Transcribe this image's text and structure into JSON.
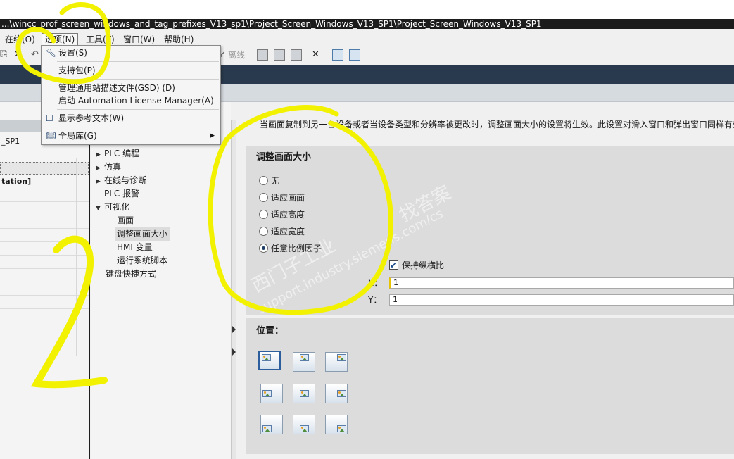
{
  "window": {
    "title": "...\\wincc_prof_screen_windows_and_tag_prefixes_V13_sp1\\Project_Screen_Windows_V13_SP1\\Project_Screen_Windows_V13_SP1"
  },
  "menubar": {
    "items": [
      {
        "label": "在线(O)"
      },
      {
        "label": "选项(N)"
      },
      {
        "label": "工具(T)"
      },
      {
        "label": "窗口(W)"
      },
      {
        "label": "帮助(H)"
      }
    ]
  },
  "toolbar": {
    "offline_label": "离线"
  },
  "options_menu": {
    "settings": "设置(S)",
    "support_packages": "支持包(P)",
    "manage_gsd": "管理通用站描述文件(GSD) (D)",
    "start_alm": "启动 Automation License Manager(A)",
    "show_reference_text": "显示参考文本(W)",
    "global_libraries": "全局库(G)"
  },
  "left_panel": {
    "row1": "_SP1",
    "row2": "tation]"
  },
  "tree": {
    "items": [
      {
        "label": "PLC 编程",
        "expand": "▶"
      },
      {
        "label": "仿真",
        "expand": "▶"
      },
      {
        "label": "在线与诊断",
        "expand": "▶"
      },
      {
        "label": "PLC 报警",
        "expand": ""
      },
      {
        "label": "可视化",
        "expand": "▼"
      },
      {
        "label": "画面",
        "expand": ""
      },
      {
        "label": "调整画面大小",
        "expand": ""
      },
      {
        "label": "HMI 变量",
        "expand": ""
      },
      {
        "label": "运行系统脚本",
        "expand": ""
      },
      {
        "label": "键盘快捷方式",
        "expand": ""
      }
    ]
  },
  "content": {
    "info_text": "当画面复制到另一台设备或者当设备类型和分辨率被更改时，调整画面大小的设置将生效。此设置对滑入窗口和弹出窗口同样有效",
    "resize_title": "调整画面大小",
    "radios": [
      {
        "label": "无",
        "checked": false
      },
      {
        "label": "适应画面",
        "checked": false
      },
      {
        "label": "适应高度",
        "checked": false
      },
      {
        "label": "适应宽度",
        "checked": false
      },
      {
        "label": "任意比例因子",
        "checked": true
      }
    ],
    "keep_aspect_label": "保持纵横比",
    "keep_aspect_checked": true,
    "x_label": "X：",
    "x_value": "1",
    "y_label": "Y：",
    "y_value": "1",
    "position_title": "位置："
  },
  "watermark": {
    "line1": "西门子工业",
    "line2": "找答案",
    "line3": "support.industry.siemens.com/cs"
  },
  "annotations": {
    "color": "#f2f200",
    "number_2": "2"
  }
}
